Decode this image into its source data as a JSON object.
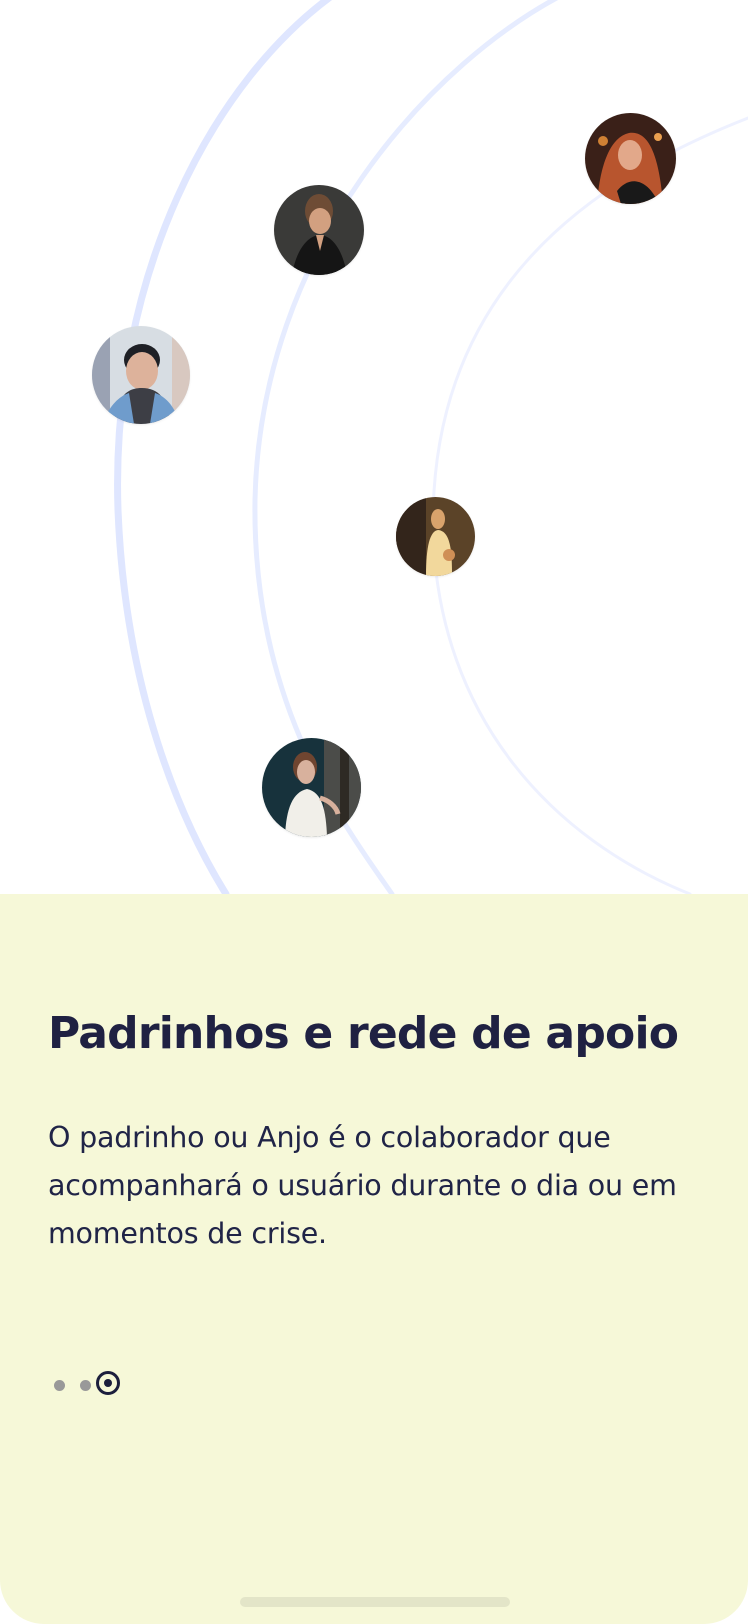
{
  "screen": {
    "title": "Padrinhos e rede de apoio",
    "description": "O padrinho ou Anjo é o colaborador que acompanhará o usuário durante o dia ou em momentos de crise."
  },
  "pager": {
    "page_count": 3,
    "active_page": 3
  },
  "colors": {
    "sheet_background": "#f6f8d8",
    "heading": "#1f2142",
    "body_text": "#202447",
    "orbit_line": "#dfe6ff",
    "inactive_dot": "#999999",
    "active_dot": "#1c1f3d"
  },
  "icons": {
    "pager_inactive": "small-dot",
    "pager_active": "ring-dot"
  }
}
